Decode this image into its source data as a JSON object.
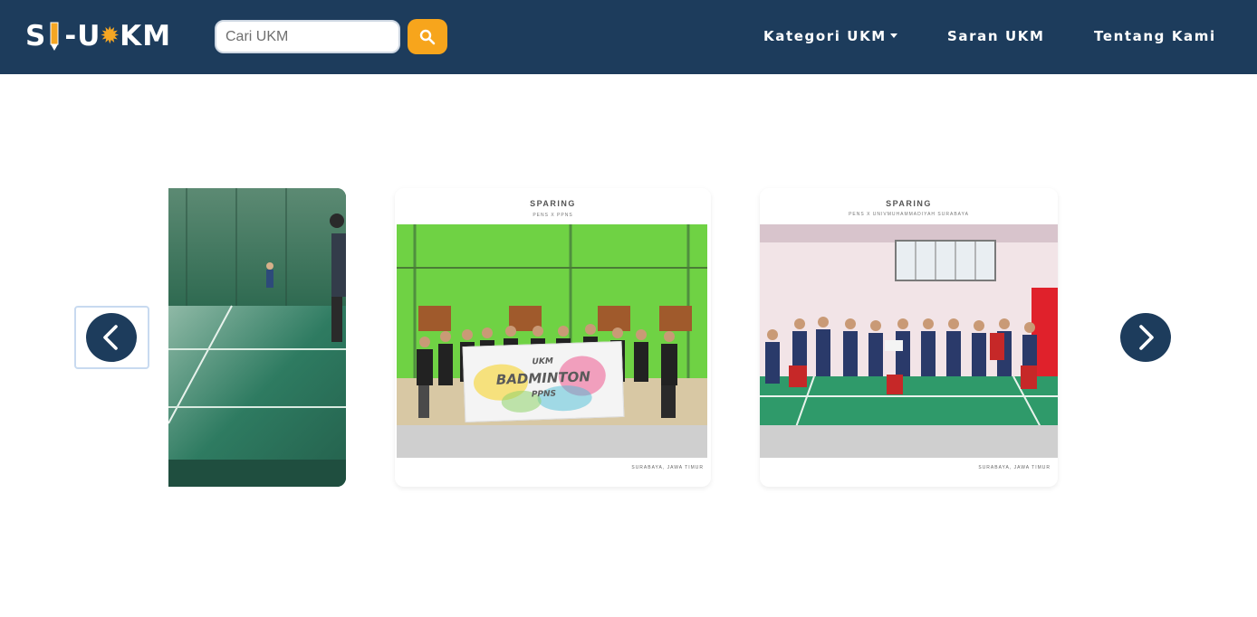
{
  "header": {
    "logo_text_left": "S",
    "logo_text_mid": "-U",
    "logo_text_right": "KM",
    "search": {
      "placeholder": "Cari UKM",
      "value": ""
    },
    "nav": {
      "kategori_label": "Kategori UKM",
      "saran_label": "Saran UKM",
      "tentang_label": "Tentang Kami"
    }
  },
  "carousel": {
    "slides": [
      {
        "title": "",
        "subtitle": "",
        "caption": ""
      },
      {
        "title": "SPARING",
        "subtitle": "PENS X PPNS",
        "caption": "SURABAYA, JAWA TIMUR",
        "banner_line1": "UKM",
        "banner_line2": "BADMINTON",
        "banner_line3": "PPNS"
      },
      {
        "title": "SPARING",
        "subtitle": "PENS X UNIVMUHAMMADIYAH SURABAYA",
        "caption": "SURABAYA, JAWA TIMUR"
      }
    ]
  },
  "colors": {
    "navbar": "#1d3c5c",
    "accent": "#f7a51c",
    "arrow": "#1d3c5c"
  },
  "icons": {
    "search": "magnifier-icon",
    "prev": "chevron-left-icon",
    "next": "chevron-right-icon"
  }
}
